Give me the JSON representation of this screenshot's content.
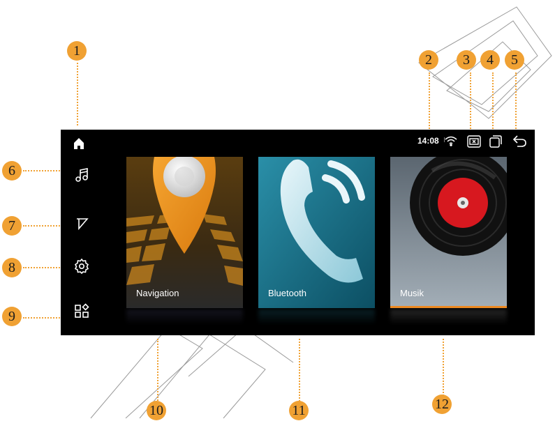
{
  "callouts": [
    "1",
    "2",
    "3",
    "4",
    "5",
    "6",
    "7",
    "8",
    "9",
    "10",
    "11",
    "12"
  ],
  "status": {
    "time": "14:08"
  },
  "sidebar": {
    "items": [
      "home-icon",
      "music-icon",
      "navigation-icon",
      "settings-icon",
      "apps-icon"
    ]
  },
  "cards": [
    {
      "label": "Navigation"
    },
    {
      "label": "Bluetooth"
    },
    {
      "label": "Musik"
    }
  ],
  "colors": {
    "accent": "#f0a133",
    "screen": "#000000",
    "active_underline": "#f28a1e"
  }
}
